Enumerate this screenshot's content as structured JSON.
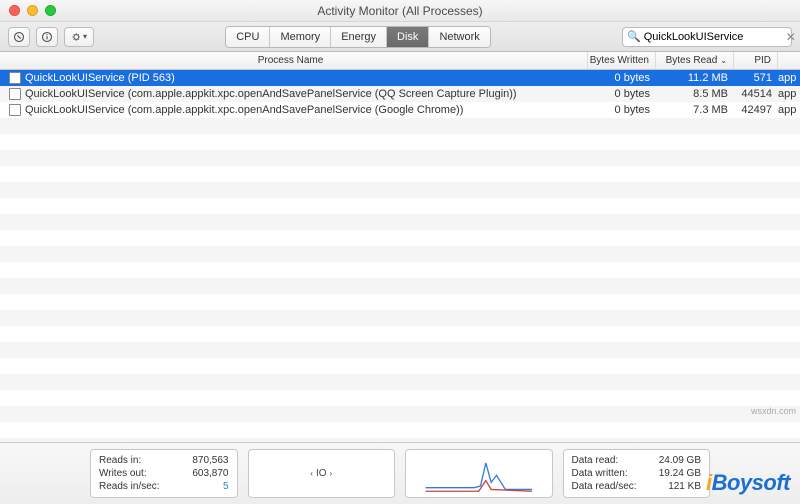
{
  "title": "Activity Monitor (All Processes)",
  "toolbar": {
    "tabs": [
      "CPU",
      "Memory",
      "Energy",
      "Disk",
      "Network"
    ],
    "active_tab": 3,
    "search_value": "QuickLookUIService"
  },
  "columns": {
    "process_name": "Process Name",
    "bytes_written": "Bytes Written",
    "bytes_read": "Bytes Read",
    "pid": "PID",
    "sort_indicator": "⌄"
  },
  "processes": [
    {
      "name": "QuickLookUIService (PID 563)",
      "bytes_written": "0 bytes",
      "bytes_read": "11.2 MB",
      "pid": "571",
      "user": "app",
      "selected": true
    },
    {
      "name": "QuickLookUIService (com.apple.appkit.xpc.openAndSavePanelService (QQ Screen Capture Plugin))",
      "bytes_written": "0 bytes",
      "bytes_read": "8.5 MB",
      "pid": "44514",
      "user": "app",
      "selected": false
    },
    {
      "name": "QuickLookUIService (com.apple.appkit.xpc.openAndSavePanelService (Google Chrome))",
      "bytes_written": "0 bytes",
      "bytes_read": "7.3 MB",
      "pid": "42497",
      "user": "app",
      "selected": false
    }
  ],
  "footer": {
    "left": {
      "reads_in_label": "Reads in:",
      "reads_in": "870,563",
      "writes_out_label": "Writes out:",
      "writes_out": "603,870",
      "reads_in_sec_label": "Reads in/sec:",
      "reads_in_sec": "5"
    },
    "io_label": "IO",
    "right": {
      "data_read_label": "Data read:",
      "data_read": "24.09 GB",
      "data_written_label": "Data written:",
      "data_written": "19.24 GB",
      "data_read_sec_label": "Data read/sec:",
      "data_read_sec": "121 KB"
    }
  },
  "logo_text": "iBoysoft",
  "watermark": "wsxdn.com"
}
